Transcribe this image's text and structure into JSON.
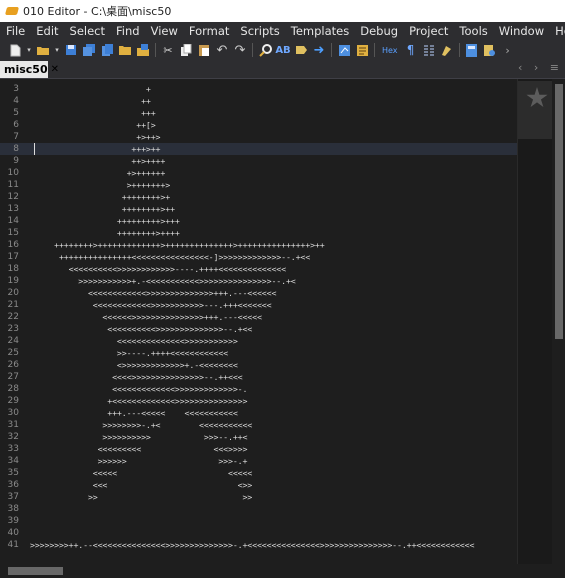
{
  "window": {
    "title": "010 Editor - C:\\桌面\\misc50"
  },
  "menu": [
    "File",
    "Edit",
    "Select",
    "Find",
    "View",
    "Format",
    "Scripts",
    "Templates",
    "Debug",
    "Project",
    "Tools",
    "Window",
    "Help"
  ],
  "toolbar": {
    "icons": [
      "new-file-icon",
      "open-icon",
      "save-icon",
      "save-all-icon",
      "copy-file-icon",
      "open-folder-icon",
      "workspace-icon",
      "cut-icon",
      "copy-icon",
      "paste-icon",
      "undo-icon",
      "redo-icon",
      "find-icon",
      "replace-icon",
      "goto-icon",
      "next-icon",
      "script-icon",
      "template-icon",
      "hex-toggle-icon",
      "pilcrow-icon",
      "columns-icon",
      "highlight-icon",
      "calculator-icon",
      "inspector-icon",
      "more-icon"
    ],
    "hex_label": "Hex"
  },
  "tab": {
    "label": "misc50",
    "close": "✕"
  },
  "tab_nav": {
    "prev": "‹",
    "next": "›",
    "menu": "≡"
  },
  "editor": {
    "current_line": 8,
    "lines": [
      {
        "n": "3",
        "text": "                        +"
      },
      {
        "n": "4",
        "text": "                       ++"
      },
      {
        "n": "5",
        "text": "                       +++"
      },
      {
        "n": "6",
        "text": "                      ++[>"
      },
      {
        "n": "7",
        "text": "                      +>++>"
      },
      {
        "n": "8",
        "text": "                     +++>++"
      },
      {
        "n": "9",
        "text": "                     ++>++++"
      },
      {
        "n": "10",
        "text": "                    +>++++++"
      },
      {
        "n": "11",
        "text": "                    >+++++++>"
      },
      {
        "n": "12",
        "text": "                   ++++++++>+"
      },
      {
        "n": "13",
        "text": "                   ++++++++>++"
      },
      {
        "n": "14",
        "text": "                  +++++++++>+++"
      },
      {
        "n": "15",
        "text": "                  ++++++++>++++"
      },
      {
        "n": "16",
        "text": "     ++++++++>+++++++++++++>++++++++++++++>+++++++++++++++>++"
      },
      {
        "n": "17",
        "text": "      +++++++++++++++<<<<<<<<<<<<<<<<-]>>>>>>>>>>>>>--.+<<"
      },
      {
        "n": "18",
        "text": "        <<<<<<<<<<>>>>>>>>>>>>----.++++<<<<<<<<<<<<<<"
      },
      {
        "n": "19",
        "text": "          >>>>>>>>>>>+.-<<<<<<<<<<<>>>>>>>>>>>>>>>--.+<"
      },
      {
        "n": "20",
        "text": "            <<<<<<<<<<<<>>>>>>>>>>>>>>+++.---<<<<<<"
      },
      {
        "n": "21",
        "text": "             <<<<<<<<<<<<>>>>>>>>>>>---.+++<<<<<<<"
      },
      {
        "n": "22",
        "text": "               <<<<<<>>>>>>>>>>>>>>>+++.---<<<<<"
      },
      {
        "n": "23",
        "text": "                <<<<<<<<<<>>>>>>>>>>>>>>--.+<<"
      },
      {
        "n": "24",
        "text": "                  <<<<<<<<<<<<<<>>>>>>>>>>>"
      },
      {
        "n": "25",
        "text": "                  >>----.++++<<<<<<<<<<<<"
      },
      {
        "n": "26",
        "text": "                  <>>>>>>>>>>>>>+.-<<<<<<<<"
      },
      {
        "n": "27",
        "text": "                 <<<<>>>>>>>>>>>>>>>--.++<<<"
      },
      {
        "n": "28",
        "text": "                 <<<<<<<<<<<<<>>>>>>>>>>>>>-."
      },
      {
        "n": "29",
        "text": "                +<<<<<<<<<<<<<>>>>>>>>>>>>>>>"
      },
      {
        "n": "30",
        "text": "                +++.---<<<<<    <<<<<<<<<<<"
      },
      {
        "n": "31",
        "text": "               >>>>>>>>-.+<        <<<<<<<<<<<"
      },
      {
        "n": "32",
        "text": "               >>>>>>>>>>           >>>--.++<"
      },
      {
        "n": "33",
        "text": "              <<<<<<<<<               <<<>>>>"
      },
      {
        "n": "34",
        "text": "              >>>>>>                   >>>-.+"
      },
      {
        "n": "35",
        "text": "             <<<<<                       <<<<<"
      },
      {
        "n": "36",
        "text": "             <<<                           <>>"
      },
      {
        "n": "37",
        "text": "            >>                              >>"
      },
      {
        "n": "38",
        "text": ""
      },
      {
        "n": "39",
        "text": ""
      },
      {
        "n": "40",
        "text": ""
      },
      {
        "n": "41",
        "text": ">>>>>>>>++.--<<<<<<<<<<<<<<<>>>>>>>>>>>>>>-.+<<<<<<<<<<<<<<<>>>>>>>>>>>>>>>--.++<<<<<<<<<<<<"
      }
    ]
  },
  "colors": {
    "background": "#1e1e1e",
    "menubar": "#2d2d30",
    "text": "#dcdcdc",
    "line_numbers": "#8a8a8a",
    "current_line": "#2a2f3a"
  }
}
